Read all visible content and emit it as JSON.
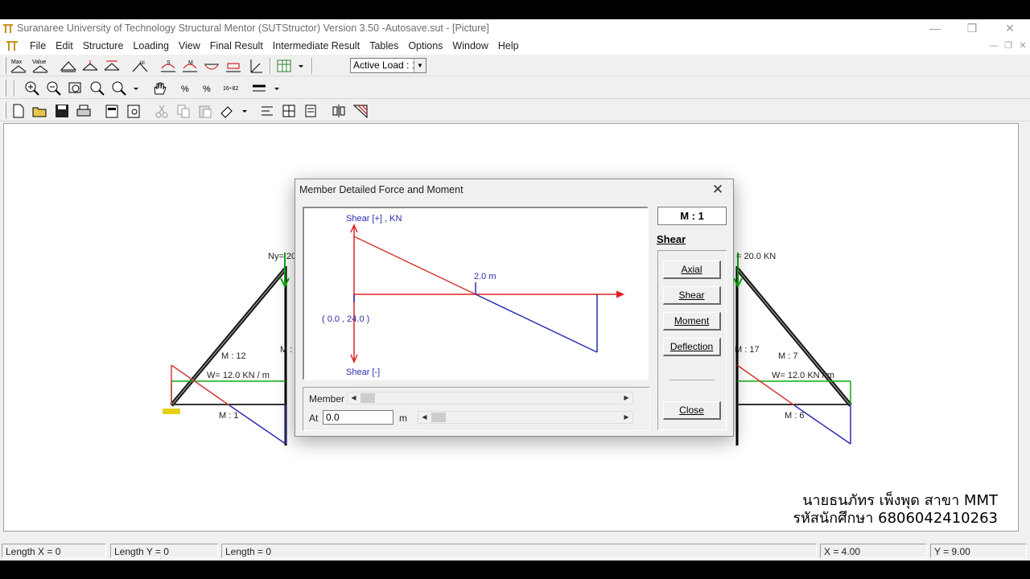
{
  "window": {
    "title": "Suranaree University of Technology Structural Mentor (SUTStructor) Version 3.50 -Autosave.sut - [Picture]",
    "controls": {
      "minimize": "—",
      "restore": "❐",
      "close": "✕"
    }
  },
  "menu": [
    "File",
    "Edit",
    "Structure",
    "Loading",
    "View",
    "Final Result",
    "Intermediate Result",
    "Tables",
    "Options",
    "Window",
    "Help"
  ],
  "toolbar1": {
    "max_label": "Max",
    "value_label": "Value",
    "active_load": "Active Load : 1"
  },
  "toolbar2": {
    "grid_label": "16÷82"
  },
  "canvas": {
    "left_frame": {
      "ny_label": "Ny= 20",
      "member_label_a": "M : 12",
      "member_label_b": "M :",
      "load_label": "W= 12.0 KN / m",
      "member_label_c": "M : 1"
    },
    "right_frame": {
      "ny_label": "= 20.0 KN",
      "member_label_a": "M : 17",
      "member_label_b": "M : 7",
      "load_label": "W= 12.0 KN / m",
      "member_label_c": "M : 6"
    }
  },
  "dialog": {
    "title": "Member Detailed Force and Moment",
    "close_icon": "✕",
    "member_id": "M : 1",
    "current_diagram": "Shear",
    "buttons": [
      "Axial",
      "Shear",
      "Moment",
      "Deflection"
    ],
    "close_button": "Close",
    "member_label": "Member",
    "at_label": "At",
    "at_value": "0.0",
    "at_unit": "m",
    "plot": {
      "top_label": "Shear [+] , KN",
      "bottom_label": "Shear [-]",
      "zero_label": "2.0 m",
      "origin_label": "( 0.0 , 24.0 )"
    }
  },
  "chart_data": {
    "type": "line",
    "title": "",
    "xlabel": "",
    "ylabel": "Shear [+] , KN",
    "x": [
      0.0,
      2.0,
      4.0
    ],
    "series": [
      {
        "values": [
          24.0,
          0.0,
          -24.0
        ]
      }
    ],
    "annotations": [
      "2.0 m",
      "( 0.0 , 24.0 )",
      "Shear [-]"
    ],
    "colors": {
      "positive": "#d63838",
      "negative": "#2b2bb0",
      "axis": "#e02020"
    }
  },
  "status": {
    "length_x": "Length X = 0",
    "length_y": "Length Y = 0",
    "length": "Length = 0",
    "x": "X = 4.00",
    "y": "Y = 9.00"
  },
  "overlay": {
    "line1": "นายธนภัทร เพ็งพุด สาขา MMT",
    "line2": "รหัสนักศึกษา 6806042410263"
  }
}
